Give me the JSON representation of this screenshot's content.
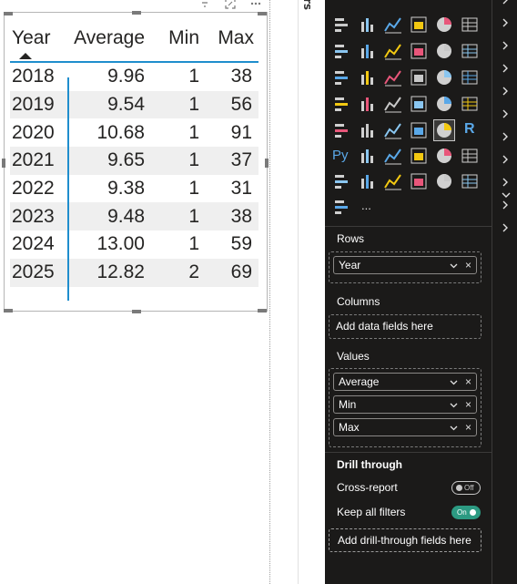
{
  "matrix": {
    "headers": {
      "year": "Year",
      "average": "Average",
      "min": "Min",
      "max": "Max"
    },
    "rows": [
      {
        "year": "2018",
        "average": "9.96",
        "min": "1",
        "max": "38"
      },
      {
        "year": "2019",
        "average": "9.54",
        "min": "1",
        "max": "56"
      },
      {
        "year": "2020",
        "average": "10.68",
        "min": "1",
        "max": "91"
      },
      {
        "year": "2021",
        "average": "9.65",
        "min": "1",
        "max": "37"
      },
      {
        "year": "2022",
        "average": "9.38",
        "min": "1",
        "max": "31"
      },
      {
        "year": "2023",
        "average": "9.48",
        "min": "1",
        "max": "38"
      },
      {
        "year": "2024",
        "average": "13.00",
        "min": "1",
        "max": "59"
      },
      {
        "year": "2025",
        "average": "12.82",
        "min": "2",
        "max": "69"
      }
    ],
    "sort": "ascending"
  },
  "visual_header": {
    "icons": [
      "filter-icon",
      "focus-mode-icon",
      "more-options-icon"
    ]
  },
  "side_strip": {
    "label": "rs"
  },
  "visualizations": {
    "gallery": [
      "stacked-bar-chart",
      "stacked-column-chart",
      "clustered-bar-chart",
      "clustered-column-chart",
      "100-stacked-bar-chart",
      "100-stacked-column-chart",
      "line-chart",
      "area-chart",
      "stacked-area-chart",
      "ribbon-chart",
      "line-clustered-column-chart",
      "line-stacked-column-chart",
      "line-and-area-chart",
      "waterfall-chart",
      "funnel-chart",
      "scatter-chart",
      "pie-chart",
      "donut-chart",
      "treemap",
      "map",
      "filled-map",
      "azure-map",
      "gauge",
      "card",
      "multi-row-card",
      "kpi",
      "slicer",
      "table",
      "matrix",
      "r-visual",
      "python-visual",
      "key-influencers",
      "decomposition-tree",
      "qa",
      "smart-narrative",
      "goals",
      "paginated-report",
      "power-apps",
      "power-automate",
      "arcgis-map",
      "custom-visual-diamond",
      "chevron-visual",
      "get-more-visuals",
      "more-visuals"
    ],
    "selected": "matrix",
    "r_label": "R",
    "python_label": "Py",
    "more_label": "...",
    "rows": {
      "title": "Rows",
      "fields": [
        "Year"
      ]
    },
    "columns": {
      "title": "Columns",
      "placeholder": "Add data fields here"
    },
    "values": {
      "title": "Values",
      "fields": [
        "Average",
        "Min",
        "Max"
      ]
    },
    "drill_through": {
      "title": "Drill through",
      "cross_report": {
        "label": "Cross-report",
        "state": "Off"
      },
      "keep_all_filters": {
        "label": "Keep all filters",
        "state": "On"
      },
      "placeholder": "Add drill-through fields here"
    }
  },
  "colors": {
    "accent_blue": "#1f8ecd",
    "pane_bg": "#1b1a19",
    "toggle_on": "#2c9a82",
    "alt_row": "#efefef"
  },
  "right_rail": {
    "chevron_count": 12
  }
}
